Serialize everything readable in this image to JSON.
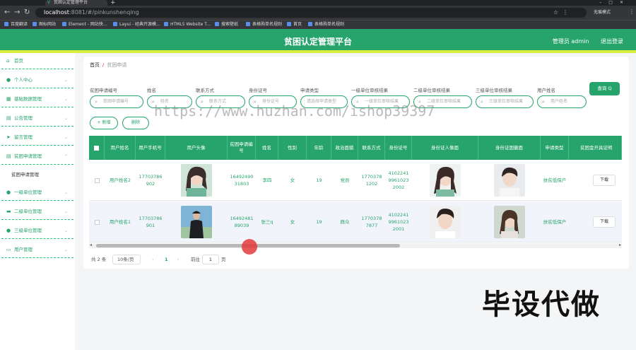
{
  "browser": {
    "tab_title": "贫困认定管理平台",
    "url_host": "localhost",
    "url_path": ":8081/#/pinkunshenqing",
    "bookmarks": [
      "百度翻译",
      "图标网站",
      "Element - 网站快...",
      "Layui - 经典开源模...",
      "HTML5 Website T...",
      "搜索壁纸",
      "表格购单名规则",
      "首页",
      "表格购单名规则"
    ],
    "profile_label": "无痕模式"
  },
  "header": {
    "title": "贫困认定管理平台",
    "user_label": "管理员 admin",
    "logout_label": "退出登录"
  },
  "sidebar": {
    "items": [
      {
        "label": "首页",
        "icon": "home-icon"
      },
      {
        "label": "个人中心",
        "icon": "user-icon"
      },
      {
        "label": "基础数据管理",
        "icon": "grid-icon"
      },
      {
        "label": "公告管理",
        "icon": "doc-icon"
      },
      {
        "label": "留言管理",
        "icon": "send-icon"
      },
      {
        "label": "贫困申请管理",
        "icon": "list-icon"
      },
      {
        "label": "一级单位管理",
        "icon": "user-icon"
      },
      {
        "label": "二级单位管理",
        "icon": "folder-icon"
      },
      {
        "label": "三级单位管理",
        "icon": "user-icon"
      },
      {
        "label": "用户管理",
        "icon": "chat-icon"
      }
    ],
    "sub_item": "贫困申请管理"
  },
  "breadcrumb": {
    "home": "首页",
    "current": "贫困申请"
  },
  "filters": [
    {
      "label": "贫困申请编号",
      "placeholder": "贫困申请编号"
    },
    {
      "label": "姓名",
      "placeholder": "姓名"
    },
    {
      "label": "联系方式",
      "placeholder": "联系方式"
    },
    {
      "label": "身份证号",
      "placeholder": "身份证号"
    },
    {
      "label": "申请类型",
      "placeholder": "请选择申请类型"
    },
    {
      "label": "一级单位审核结果",
      "placeholder": "一级单位审核结果"
    },
    {
      "label": "二级单位审核结果",
      "placeholder": "二级单位审核结果"
    },
    {
      "label": "三级单位审核结果",
      "placeholder": "三级单位审核结果"
    },
    {
      "label": "用户姓名",
      "placeholder": "用户姓名"
    }
  ],
  "buttons": {
    "search": "查询 Q",
    "add": "+ 新增",
    "delete": "删除"
  },
  "table": {
    "headers": [
      "用户姓名",
      "用户手机号",
      "用户头像",
      "贫困申请编号",
      "姓名",
      "性别",
      "年龄",
      "政治面貌",
      "联系方式",
      "身份证号",
      "身份证人像面",
      "身份证国徽面",
      "申请类型",
      "贫困金开具证明"
    ],
    "rows": [
      {
        "user_name": "用户姓名2",
        "phone": "17703786902",
        "apply_no": "1649249031803",
        "name": "李四",
        "gender": "女",
        "age": "19",
        "politics": "党员",
        "contact": "17703781202",
        "id_no": "410224199610232002",
        "type": "扶贫低保户",
        "action": "下载"
      },
      {
        "user_name": "用户姓名1",
        "phone": "17703786901",
        "apply_no": "1649248189039",
        "name": "张三q",
        "gender": "女",
        "age": "19",
        "politics": "群众",
        "contact": "17703787877",
        "id_no": "410224199610232001",
        "type": "扶贫低保户",
        "action": "下载"
      }
    ]
  },
  "pagination": {
    "total": "共 2 条",
    "page_size": "10条/页",
    "prev": "‹",
    "page": "1",
    "next": "›",
    "goto_label": "前往",
    "goto_value": "1",
    "page_unit": "页"
  },
  "watermark": "https://www.huzhan.com/ishop39397",
  "overlay_text": "毕设代做"
}
